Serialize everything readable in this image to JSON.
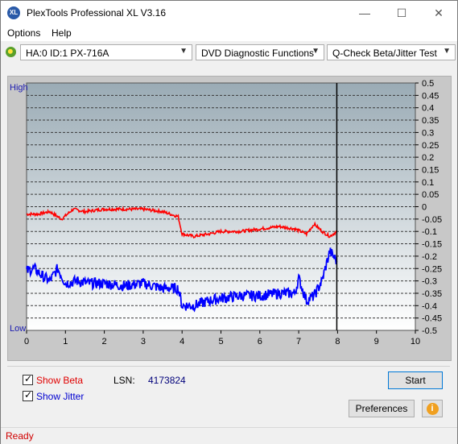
{
  "window": {
    "title": "PlexTools Professional XL V3.16",
    "icon_label": "XL"
  },
  "menu": {
    "options": "Options",
    "help": "Help"
  },
  "toolbar": {
    "drive": "HA:0 ID:1  PX-716A",
    "function": "DVD Diagnostic Functions",
    "test": "Q-Check Beta/Jitter Test"
  },
  "chart": {
    "left_label_high": "High",
    "left_label_low": "Low",
    "x_ticks": [
      "0",
      "1",
      "2",
      "3",
      "4",
      "5",
      "6",
      "7",
      "8",
      "9",
      "10"
    ],
    "y_ticks": [
      "0.5",
      "0.45",
      "0.4",
      "0.35",
      "0.3",
      "0.25",
      "0.2",
      "0.15",
      "0.1",
      "0.05",
      "0",
      "-0.05",
      "-0.1",
      "-0.15",
      "-0.2",
      "-0.25",
      "-0.3",
      "-0.35",
      "-0.4",
      "-0.45",
      "-0.5"
    ]
  },
  "chart_data": {
    "type": "line",
    "xlim": [
      0,
      10
    ],
    "ylim": [
      -0.5,
      0.5
    ],
    "cursor_x": 7.98,
    "series": [
      {
        "name": "Beta",
        "color": "#ff0000",
        "x": [
          0,
          0.3,
          0.6,
          0.9,
          1.2,
          1.5,
          2.0,
          2.5,
          3.0,
          3.5,
          3.9,
          4.0,
          4.3,
          4.7,
          5.0,
          5.5,
          6.0,
          6.5,
          6.9,
          7.2,
          7.4,
          7.6,
          7.8,
          7.98
        ],
        "y": [
          -0.03,
          -0.03,
          -0.02,
          -0.05,
          -0.01,
          -0.02,
          -0.01,
          -0.01,
          -0.01,
          -0.02,
          -0.04,
          -0.11,
          -0.12,
          -0.11,
          -0.1,
          -0.1,
          -0.09,
          -0.08,
          -0.09,
          -0.11,
          -0.07,
          -0.1,
          -0.12,
          -0.1
        ]
      },
      {
        "name": "Jitter",
        "color": "#0000ff",
        "x": [
          0,
          0.2,
          0.4,
          0.6,
          0.8,
          1.0,
          1.3,
          1.6,
          2.0,
          2.5,
          3.0,
          3.5,
          3.9,
          4.0,
          4.3,
          4.7,
          5.0,
          5.5,
          6.0,
          6.5,
          6.9,
          7.0,
          7.2,
          7.4,
          7.6,
          7.8,
          7.98
        ],
        "y": [
          -0.26,
          -0.25,
          -0.28,
          -0.3,
          -0.25,
          -0.31,
          -0.3,
          -0.31,
          -0.31,
          -0.32,
          -0.31,
          -0.33,
          -0.33,
          -0.4,
          -0.4,
          -0.38,
          -0.37,
          -0.36,
          -0.36,
          -0.35,
          -0.35,
          -0.29,
          -0.38,
          -0.36,
          -0.3,
          -0.18,
          -0.22
        ]
      }
    ]
  },
  "controls": {
    "show_beta": "Show Beta",
    "show_jitter": "Show Jitter",
    "lsn_label": "LSN:",
    "lsn_value": "4173824",
    "start": "Start",
    "preferences": "Preferences",
    "info_icon": "i"
  },
  "status": {
    "text": "Ready"
  }
}
